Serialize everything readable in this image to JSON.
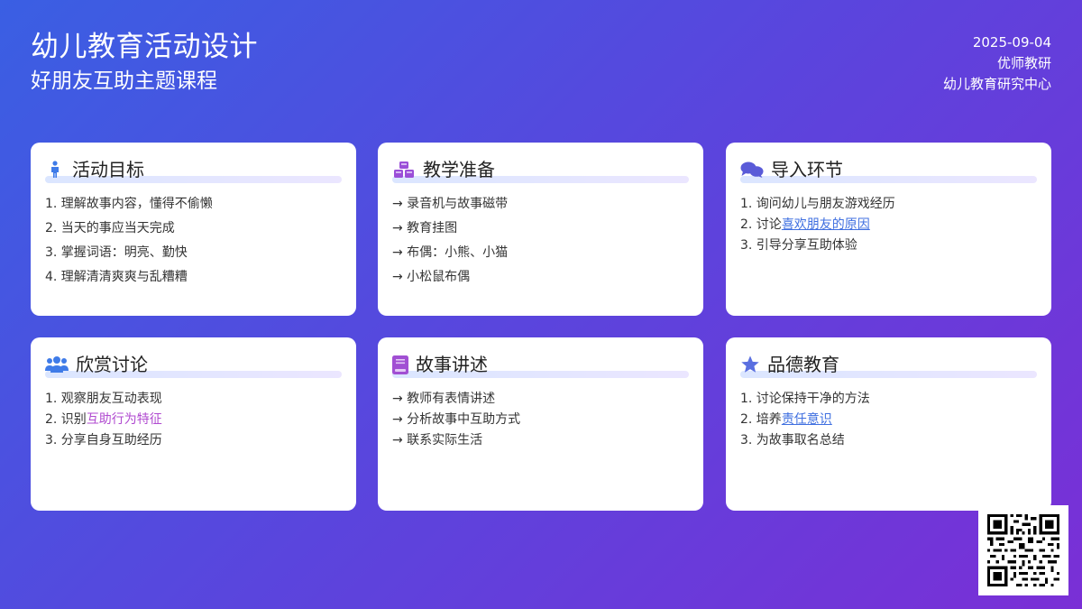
{
  "header": {
    "title": "幼儿教育活动设计",
    "subtitle": "好朋友互助主题课程",
    "date": "2025-09-04",
    "author": "优师教研",
    "org": "幼儿教育研究中心"
  },
  "cards": [
    {
      "title": "活动目标",
      "icon": "child-icon",
      "items": [
        "1. 理解故事内容，懂得不偷懒",
        "2. 当天的事应当天完成",
        "3. 掌握词语：明亮、勤快",
        "4. 理解清清爽爽与乱糟糟"
      ]
    },
    {
      "title": "教学准备",
      "icon": "cubes-icon",
      "items": [
        "→ 录音机与故事磁带",
        "→ 教育挂图",
        "→ 布偶：小熊、小猫",
        "→ 小松鼠布偶"
      ]
    },
    {
      "title": "导入环节",
      "icon": "chat-bubbles-icon",
      "items": [
        "1. 询问幼儿与朋友游戏经历",
        "2. 讨论",
        "3. 引导分享互助体验"
      ],
      "link": "喜欢朋友的原因"
    },
    {
      "title": "欣赏讨论",
      "icon": "users-icon",
      "items": [
        "1. 观察朋友互动表现",
        "2. 识别",
        "3. 分享自身互助经历"
      ],
      "link": "互助行为特征"
    },
    {
      "title": "故事讲述",
      "icon": "book-icon",
      "items": [
        "→ 教师有表情讲述",
        "→ 分析故事中互助方式",
        "→ 联系实际生活"
      ]
    },
    {
      "title": "品德教育",
      "icon": "star-icon",
      "items": [
        "1. 讨论保持干净的方法",
        "2. 培养",
        "3. 为故事取名总结"
      ],
      "link": "责任意识"
    }
  ],
  "colors": {
    "bg_start": "#3a5fe3",
    "bg_end": "#7a2fd6",
    "link_blue": "#3f6fe0",
    "link_purple": "#b04ad0"
  }
}
